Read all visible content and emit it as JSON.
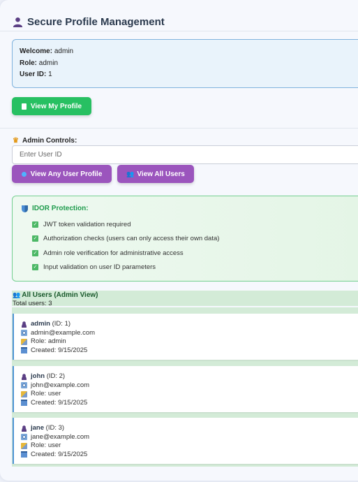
{
  "header": {
    "title": "Secure Profile Management"
  },
  "info": {
    "welcome_label": "Welcome:",
    "welcome_value": "admin",
    "role_label": "Role:",
    "role_value": "admin",
    "userid_label": "User ID:",
    "userid_value": "1"
  },
  "buttons": {
    "view_my_profile": "View My Profile",
    "view_any_profile": "View Any User Profile",
    "view_all_users": "View All Users"
  },
  "admin": {
    "label": "Admin Controls:",
    "input_placeholder": "Enter User ID"
  },
  "idor": {
    "title": "IDOR Protection:",
    "items": [
      "JWT token validation required",
      "Authorization checks (users can only access their own data)",
      "Admin role verification for administrative access",
      "Input validation on user ID parameters"
    ]
  },
  "users": {
    "title": "All Users (Admin View)",
    "total": "Total users: 3",
    "list": [
      {
        "name": "admin",
        "id": "(ID: 1)",
        "email": "admin@example.com",
        "role": "Role: admin",
        "created": "Created: 9/15/2025"
      },
      {
        "name": "john",
        "id": "(ID: 2)",
        "email": "john@example.com",
        "role": "Role: user",
        "created": "Created: 9/15/2025"
      },
      {
        "name": "jane",
        "id": "(ID: 3)",
        "email": "jane@example.com",
        "role": "Role: user",
        "created": "Created: 9/15/2025"
      }
    ]
  },
  "colors": {
    "primary_green": "#27c062",
    "primary_purple": "#9b55bd",
    "accent_blue": "#4f94d6"
  },
  "icons": {
    "header": "user-icon",
    "view_profile": "document-icon",
    "admin": "crown-icon",
    "view_any": "globe-icon",
    "view_all": "users-icon",
    "idor": "shield-icon",
    "check": "checkmark-icon",
    "email": "email-icon",
    "role": "role-icon",
    "created": "calendar-icon"
  }
}
